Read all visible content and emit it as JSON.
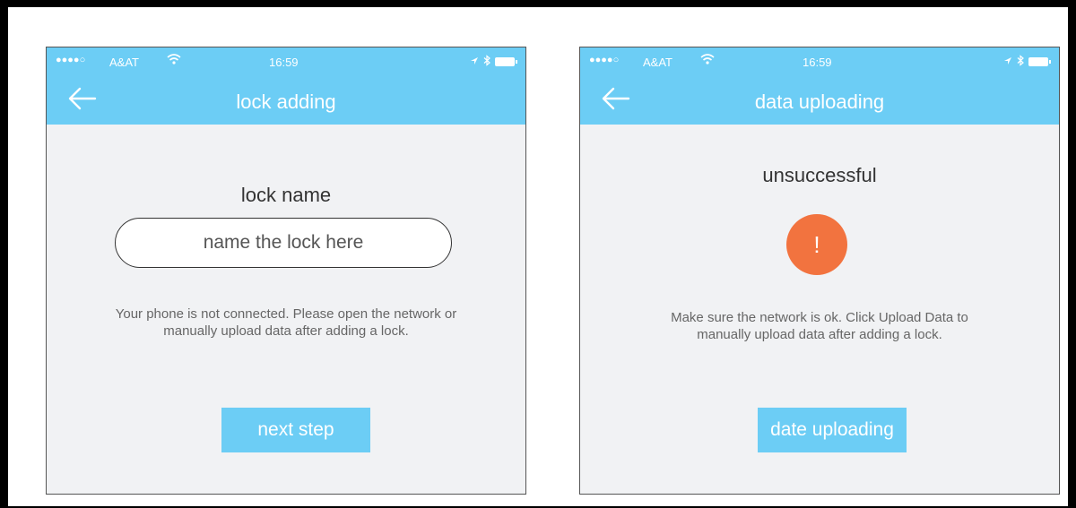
{
  "screens": [
    {
      "status": {
        "signal": "●●●●○",
        "carrier": "A&AT",
        "time": "16:59"
      },
      "title": "lock adding",
      "field_label": "lock name",
      "input": {
        "placeholder": "name the lock here",
        "value": ""
      },
      "info_line1": "Your phone is not connected. Please open the network or",
      "info_line2": "manually upload data after adding a lock.",
      "button": "next step"
    },
    {
      "status": {
        "signal": "●●●●○",
        "carrier": "A&AT",
        "time": "16:59"
      },
      "title": "data uploading",
      "result": "unsuccessful",
      "error_symbol": "!",
      "info_line1": "Make sure the network is ok. Click Upload Data to",
      "info_line2": "manually upload data after adding a lock.",
      "button": "date uploading"
    }
  ],
  "colors": {
    "header": "#6ccdf5",
    "background": "#f1f2f4",
    "error": "#f2733f",
    "button": "#6ccdf5"
  },
  "icons": [
    "back-arrow-icon",
    "wifi-icon",
    "location-icon",
    "bluetooth-icon",
    "battery-icon",
    "exclamation-icon"
  ]
}
